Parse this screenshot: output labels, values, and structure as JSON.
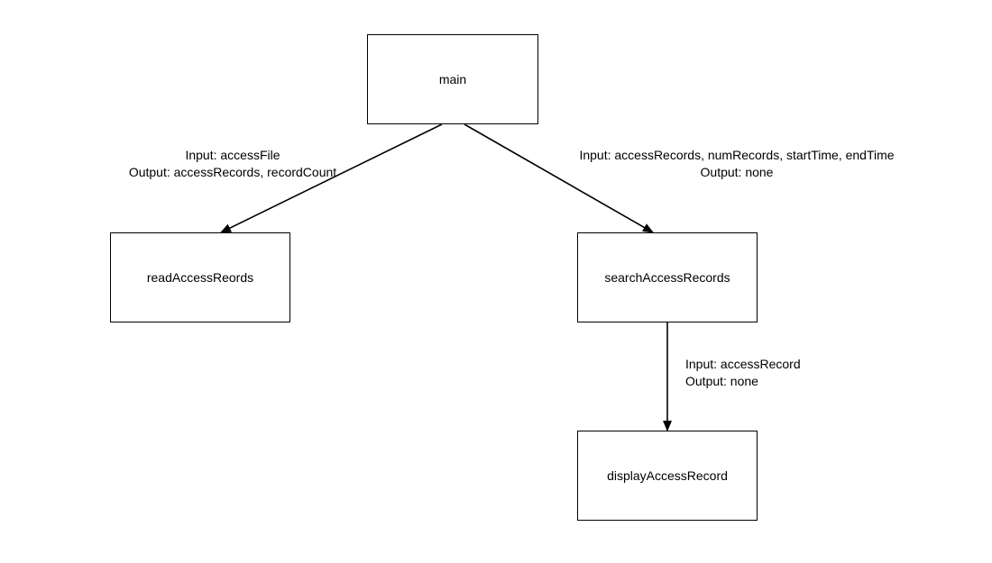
{
  "nodes": {
    "main": {
      "label": "main"
    },
    "readAccessRecords": {
      "label": "readAccessReords"
    },
    "searchAccessRecords": {
      "label": "searchAccessRecords"
    },
    "displayAccessRecord": {
      "label": "displayAccessRecord"
    }
  },
  "edges": {
    "main_to_read": {
      "input": "Input: accessFile",
      "output": "Output: accessRecords, recordCount"
    },
    "main_to_search": {
      "input": "Input: accessRecords, numRecords, startTime, endTime",
      "output": "Output: none"
    },
    "search_to_display": {
      "input": "Input: accessRecord",
      "output": "Output: none"
    }
  }
}
